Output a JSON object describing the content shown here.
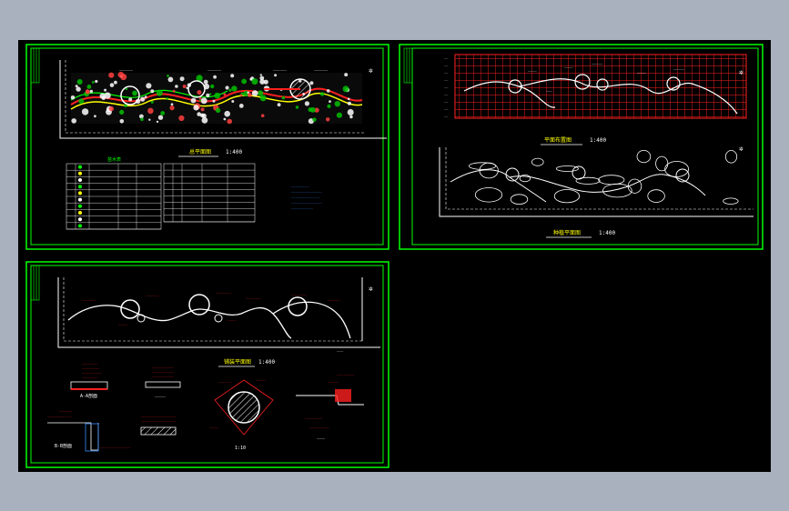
{
  "colors": {
    "background": "#a9b1bf",
    "model_space": "#000000",
    "frame": "#00ff00",
    "annotation": "#ff2020",
    "text": "#ffffff",
    "highlight": "#ffff00"
  },
  "sheets": [
    {
      "id": "sheet-1",
      "title": "总平面图",
      "scale": "1:400"
    },
    {
      "id": "sheet-2",
      "title": "平面布置图",
      "scale": "1:400",
      "title2": "种植平面图",
      "scale2": "1:400"
    },
    {
      "id": "sheet-3",
      "title": "铺装平面图",
      "scale": "1:400"
    }
  ],
  "legend_heading": "苗木表",
  "sheet3_details": [
    {
      "label": "A-A剖面"
    },
    {
      "label": "B-B剖面"
    },
    {
      "label": "1:10"
    }
  ]
}
